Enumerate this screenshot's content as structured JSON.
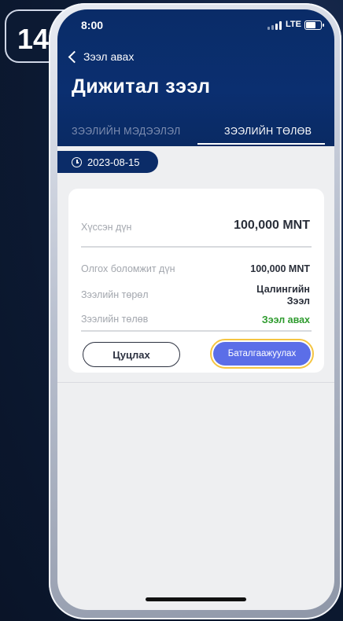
{
  "step": {
    "number": "14"
  },
  "status_bar": {
    "time": "8:00",
    "network": "LTE"
  },
  "nav": {
    "back_label": "Зээл авах"
  },
  "page": {
    "title": "Дижитал зээл"
  },
  "tabs": [
    {
      "label": "ЗЭЭЛИЙН МЭДЭЭЛЭЛ",
      "active": false
    },
    {
      "label": "ЗЭЭЛИЙН ТӨЛӨВ",
      "active": true
    }
  ],
  "date": "2023-08-15",
  "card": {
    "requested_label": "Хүссэн дүн",
    "requested_value": "100,000 MNT",
    "available_label": "Олгох боломжит дүн",
    "available_value": "100,000 MNT",
    "type_label": "Зээлийн төрөл",
    "type_value": "Цалингийн Зээл",
    "status_label": "Зээлийн төлөв",
    "status_value": "Зээл авах"
  },
  "buttons": {
    "cancel": "Цуцлах",
    "confirm": "Баталгаажуулах"
  },
  "colors": {
    "header": "#0b2f70",
    "confirm": "#5b6ee8",
    "highlight": "#f5c542",
    "status_green": "#2e9b2e"
  }
}
